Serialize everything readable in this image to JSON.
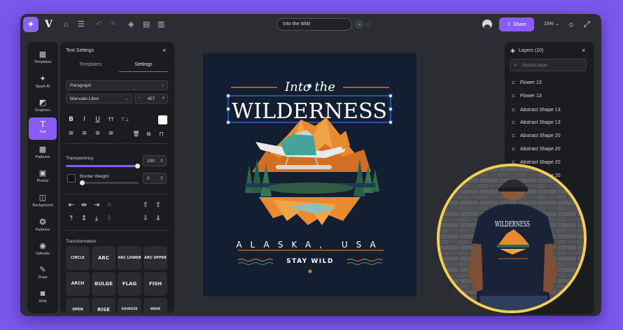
{
  "app": {
    "mark": "V",
    "document_name": "Into the Wild",
    "share_label": "Share",
    "zoom": "15%"
  },
  "icons": [
    "sparkle-icon",
    "home-icon",
    "menu-icon",
    "undo-icon",
    "redo-icon",
    "layers-icon",
    "file-icon",
    "document-icon",
    "chevron-down-icon",
    "comment-icon",
    "share-icon",
    "theme-icon",
    "expand-icon",
    "search-icon",
    "close-icon"
  ],
  "rail": [
    {
      "label": "Templates",
      "icon": "templates-icon"
    },
    {
      "label": "Spark AI",
      "icon": "spark-icon"
    },
    {
      "label": "Graphics",
      "icon": "graphics-icon"
    },
    {
      "label": "Text",
      "icon": "text-icon",
      "active": true
    },
    {
      "label": "Patterns",
      "icon": "patterns-icon"
    },
    {
      "label": "Photos",
      "icon": "photos-icon"
    },
    {
      "label": "Background",
      "icon": "background-icon"
    },
    {
      "label": "Patterns",
      "icon": "patterns-alt-icon"
    },
    {
      "label": "Uploads",
      "icon": "uploads-icon"
    },
    {
      "label": "Draw",
      "icon": "draw-icon"
    },
    {
      "label": "Help",
      "icon": "help-icon"
    }
  ],
  "text_settings": {
    "title": "Text Settings",
    "tabs": [
      "Templates",
      "Settings"
    ],
    "active_tab": "Settings",
    "style": "Paragraph",
    "font": "Manuale Libre",
    "font_size": "457",
    "minus": "−",
    "plus": "+",
    "format_buttons": [
      "B",
      "I",
      "U",
      "TT",
      "⊤⊥"
    ],
    "align_buttons": [
      "≡",
      "≡",
      "≡",
      "≡"
    ],
    "transparency_label": "Transparency",
    "transparency_value": "100",
    "transparency_level": 1.0,
    "border_label": "Border Weight",
    "border_value": "0",
    "transform_label": "Transformation",
    "transforms": [
      "CIRCLE",
      "ARC",
      "ARC LOWER",
      "ARC UPPER",
      "ARCH",
      "BULGE",
      "FLAG",
      "FISH",
      "OPEN",
      "RISE",
      "SQUEEZE",
      "WAVE LOWER"
    ]
  },
  "design": {
    "script_line": "Into the",
    "headline": "WILDERNESS",
    "location": "ALASKA, USA",
    "tagline": "STAY WILD",
    "accent": "#e98a2e",
    "background": "#141e33"
  },
  "layers_panel": {
    "title": "Layers (10)",
    "search_placeholder": "Search layer",
    "items": [
      "Flower 13",
      "Flower 13",
      "Abstract Shape 13",
      "Abstract Shape 13",
      "Abstract Shape 20",
      "Abstract Shape 20",
      "Abstract Shape 20",
      "Abstract Shape 20"
    ]
  },
  "colors": {
    "purple": "#8a5cf6",
    "page_bg": "#7b58ec",
    "frame": "#f3cf57"
  }
}
